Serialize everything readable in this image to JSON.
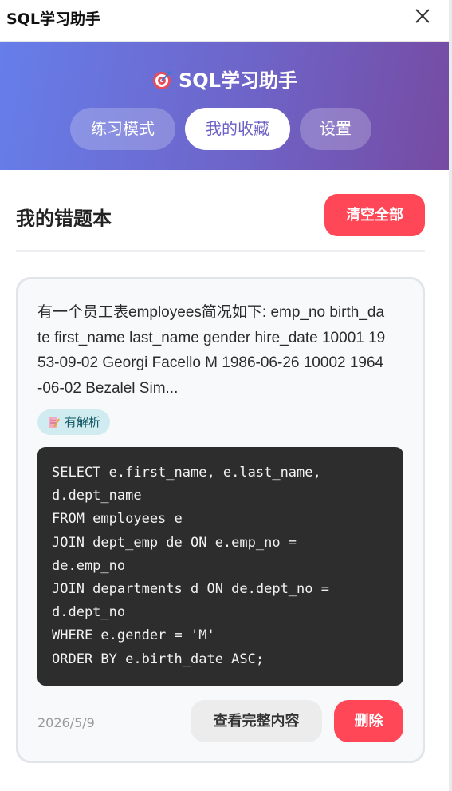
{
  "window": {
    "title": "SQL学习助手"
  },
  "header": {
    "title": "SQL学习助手",
    "tabs": [
      {
        "label": "练习模式",
        "active": false
      },
      {
        "label": "我的收藏",
        "active": true
      },
      {
        "label": "设置",
        "active": false
      }
    ]
  },
  "main": {
    "section_title": "我的错题本",
    "clear_all_label": "清空全部"
  },
  "wrong_items": [
    {
      "question": "有一个员工表employees简况如下: emp_no birth_date first_name last_name gender hire_date 10001 1953-09-02 Georgi Facello M 1986-06-26 10002 1964-06-02 Bezalel Sim...",
      "badge": "有解析",
      "code": "SELECT e.first_name, e.last_name,\nd.dept_name\nFROM employees e\nJOIN dept_emp de ON e.emp_no =\nde.emp_no\nJOIN departments d ON de.dept_no =\nd.dept_no\nWHERE e.gender = 'M'\nORDER BY e.birth_date ASC;",
      "date": "2026/5/9",
      "view_label": "查看完整内容",
      "delete_label": "删除"
    }
  ],
  "colors": {
    "gradient_start": "#667eea",
    "gradient_end": "#764ba2",
    "danger": "#ff4757",
    "code_bg": "#2d2d2d",
    "badge_bg": "#d1ecf1"
  },
  "icons": {
    "close": "close-icon",
    "logo": "target-icon",
    "badge": "memo-icon"
  }
}
